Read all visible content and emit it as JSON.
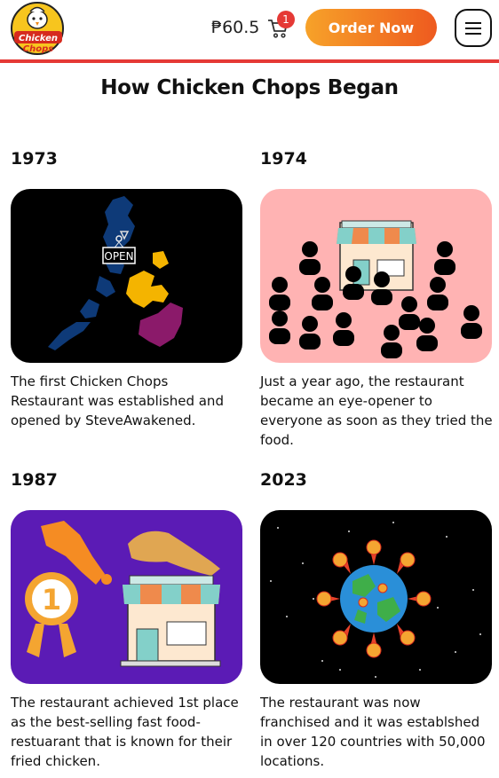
{
  "header": {
    "logo_top": "Chicken",
    "logo_bottom": "Chops",
    "price": "₱60.5",
    "cart_count": "1",
    "order_label": "Order Now"
  },
  "page_title": "How Chicken Chops Began",
  "timeline": [
    {
      "year": "1973",
      "image_sign": "OPEN",
      "text": "The first Chicken Chops Restaurant was established and opened by SteveAwakened."
    },
    {
      "year": "1974",
      "text": "Just a year ago, the restaurant became an eye-opener to everyone as soon as they tried the food."
    },
    {
      "year": "1987",
      "medal": "1",
      "text": "The restaurant achieved 1st place as the best-selling fast food-restuarant that is known for their fried chicken."
    },
    {
      "year": "2023",
      "text": "The restaurant was now franchised and it was establshed in over 120 countries with 50,000 locations."
    }
  ],
  "colors": {
    "accent_red": "#e53935",
    "order_orange": "#f28c28",
    "card_pink": "#ffb3b3",
    "card_purple": "#5b1bb5"
  }
}
